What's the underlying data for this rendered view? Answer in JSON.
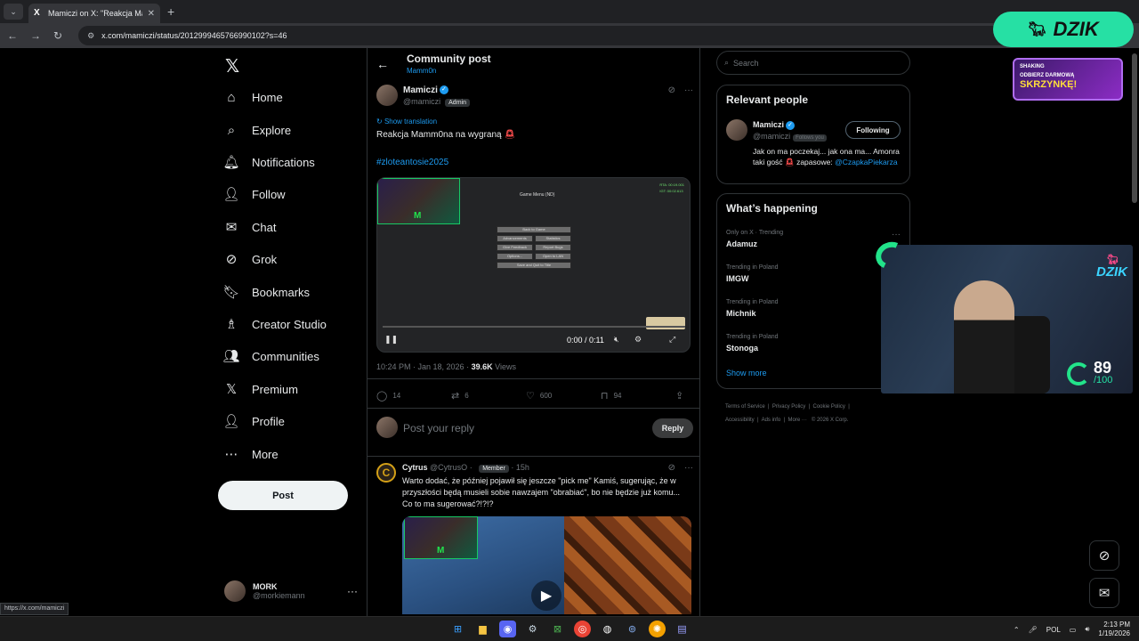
{
  "browser": {
    "tab_title": "Mamiczi on X: \"Reakcja Mamm",
    "tab_favicon": "X",
    "url": "x.com/mamiczi/status/2012999465766990102?s=46"
  },
  "nav": {
    "items": [
      {
        "label": "Home",
        "icon": "⌂"
      },
      {
        "label": "Explore",
        "icon": "⌕"
      },
      {
        "label": "Notifications",
        "icon": "🔔︎"
      },
      {
        "label": "Follow",
        "icon": "👤︎"
      },
      {
        "label": "Chat",
        "icon": "✉"
      },
      {
        "label": "Grok",
        "icon": "⊘"
      },
      {
        "label": "Bookmarks",
        "icon": "🔖︎"
      },
      {
        "label": "Creator Studio",
        "icon": "♗"
      },
      {
        "label": "Communities",
        "icon": "👥︎"
      },
      {
        "label": "Premium",
        "icon": "𝕏"
      },
      {
        "label": "Profile",
        "icon": "👤︎"
      },
      {
        "label": "More",
        "icon": "⋯"
      }
    ],
    "post_label": "Post",
    "account": {
      "name": "MORK",
      "handle": "@morkiemann"
    }
  },
  "header": {
    "title": "Community post",
    "community": "Mamm0n"
  },
  "post": {
    "author": "Mamiczi",
    "handle": "@mamiczi",
    "badge": "Admin",
    "show_translation": "Show translation",
    "text": "Reakcja Mamm0na na wygraną",
    "hashtag": "#zloteantosie2025",
    "video": {
      "time": "0:00 / 0:11",
      "menu_title": "Game Menu (ND)",
      "menu_buttons": [
        "Back to Game",
        "Advancements",
        "Statistics",
        "Give Feedback",
        "Report Bugs",
        "Options...",
        "Open to LAN",
        "Save and Quit to Title"
      ],
      "stats": [
        "RTA: 00:19.001",
        "IGT: 00:02.613"
      ]
    },
    "timestamp": "10:24 PM · Jan 18, 2026 · ",
    "views_count": "39.6K",
    "views_label": " Views",
    "stats": {
      "replies": "14",
      "reposts": "6",
      "likes": "600",
      "bookmarks": "94"
    }
  },
  "reply_box": {
    "placeholder": "Post your reply",
    "button": "Reply"
  },
  "reply": {
    "author": "Cytrus",
    "handle": "@CytrusO",
    "badge": "Member",
    "time": "15h",
    "text": "Warto dodać, że później pojawił się jeszcze \"pick me\" Kamiś, sugerując, że w przyszłości będą musieli sobie nawzajem \"obrabiać\", bo nie będzie już komu... Co to ma sugerować?!?!?"
  },
  "sidebar": {
    "search_placeholder": "Search",
    "relevant_title": "Relevant people",
    "relevant": {
      "name": "Mamiczi",
      "handle": "@mamiczi",
      "follows_you": "Follows you",
      "button": "Following",
      "bio_1": "Jak on ma poczekaj... jak ona ma... Amonra taki gość",
      "bio_2": " zapasowe: ",
      "mention": "@CzapkaPiekarza"
    },
    "happening_title": "What’s happening",
    "trends": [
      {
        "context": "Only on X · Trending",
        "name": "Adamuz"
      },
      {
        "context": "Trending in Poland",
        "name": "IMGW"
      },
      {
        "context": "Trending in Poland",
        "name": "Michnik"
      },
      {
        "context": "Trending in Poland",
        "name": "Stonoga"
      }
    ],
    "show_more": "Show more",
    "footer": [
      "Terms of Service",
      "Privacy Policy",
      "Cookie Policy",
      "Accessibility",
      "Ads info",
      "More ···",
      "© 2026 X Corp."
    ]
  },
  "overlay": {
    "brand": "DZIK",
    "banner_top": "SHAKING",
    "banner_line1": "ODBIERZ DARMOWĄ",
    "banner_line2": "SKRZYNKĘ!",
    "meter_value": "89",
    "meter_max": "/100",
    "neon_text": "DZIK"
  },
  "status_url": "https://x.com/mamiczi",
  "taskbar": {
    "lang": "POL",
    "time": "2:13 PM",
    "date": "1/19/2026"
  },
  "colors": {
    "accent": "#1d9bf0",
    "brand_green": "#26e0a4",
    "background": "#000000"
  }
}
